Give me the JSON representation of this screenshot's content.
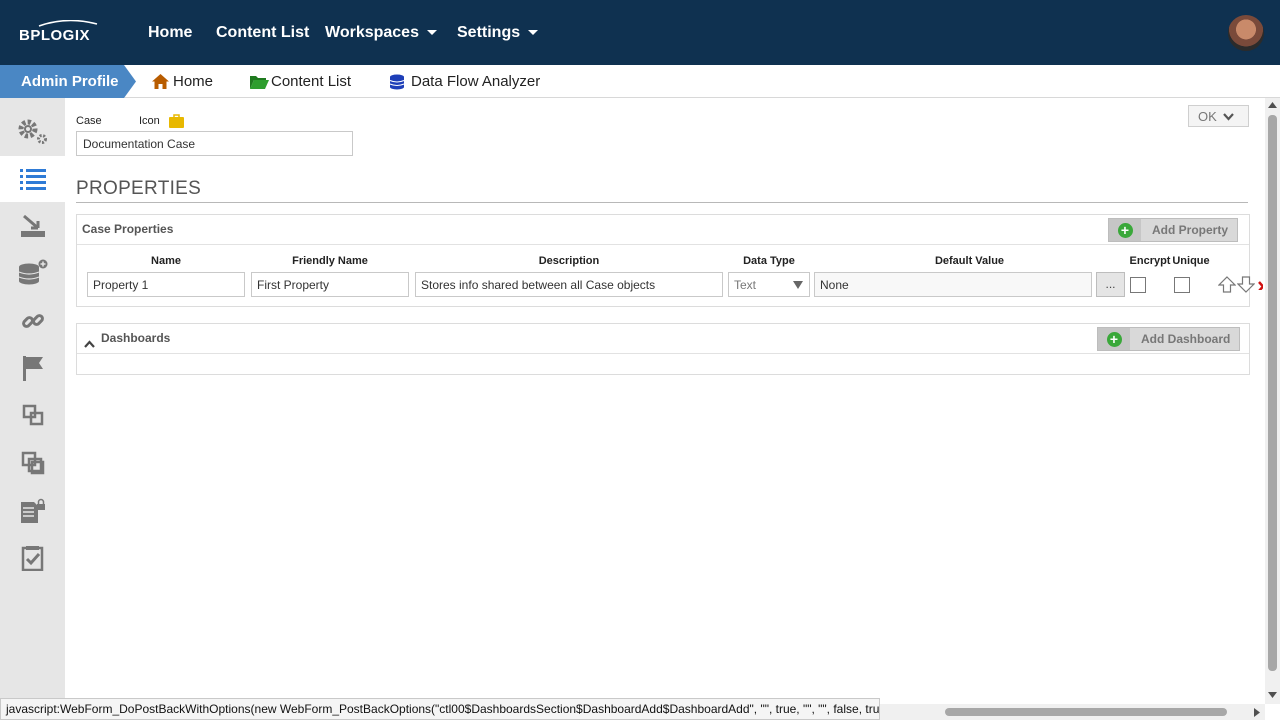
{
  "topnav": {
    "logo_text": "BPLOGIX",
    "home": "Home",
    "content_list": "Content List",
    "workspaces": "Workspaces",
    "settings": "Settings"
  },
  "breadcrumb": {
    "active": "Admin Profile",
    "home": "Home",
    "content_list": "Content List",
    "data_flow": "Data Flow Analyzer"
  },
  "sidebar": {
    "items": [
      "gear-icon",
      "list-icon",
      "import-icon",
      "database-add-icon",
      "link-icon",
      "flag-icon",
      "layers-icon",
      "copy-icon",
      "lock-document-icon",
      "checklist-icon"
    ],
    "active_index": 1
  },
  "form": {
    "case_label": "Case",
    "icon_label": "Icon",
    "case_value": "Documentation Case",
    "ok_label": "OK"
  },
  "properties": {
    "title": "PROPERTIES",
    "panel_title": "Case Properties",
    "add_button": "Add Property",
    "headers": [
      "Name",
      "Friendly Name",
      "Description",
      "Data Type",
      "Default Value",
      "Encrypt",
      "Unique"
    ],
    "rows": [
      {
        "name": "Property 1",
        "friendly_name": "First Property",
        "description": "Stores info shared between all Case objects",
        "data_type": "Text",
        "default_value": "None",
        "ellipsis": "...",
        "encrypt": false,
        "unique": false
      }
    ]
  },
  "dashboards": {
    "title": "Dashboards",
    "add_button": "Add Dashboard"
  },
  "status": {
    "text": "javascript:WebForm_DoPostBackWithOptions(new WebForm_PostBackOptions(\"ctl00$DashboardsSection$DashboardAdd$DashboardAdd\", \"\", true, \"\", \"\", false, true))"
  },
  "colors": {
    "topbar": "#0f3150",
    "breadcrumb_active": "#4a87c4",
    "add_green": "#3aa83a"
  }
}
